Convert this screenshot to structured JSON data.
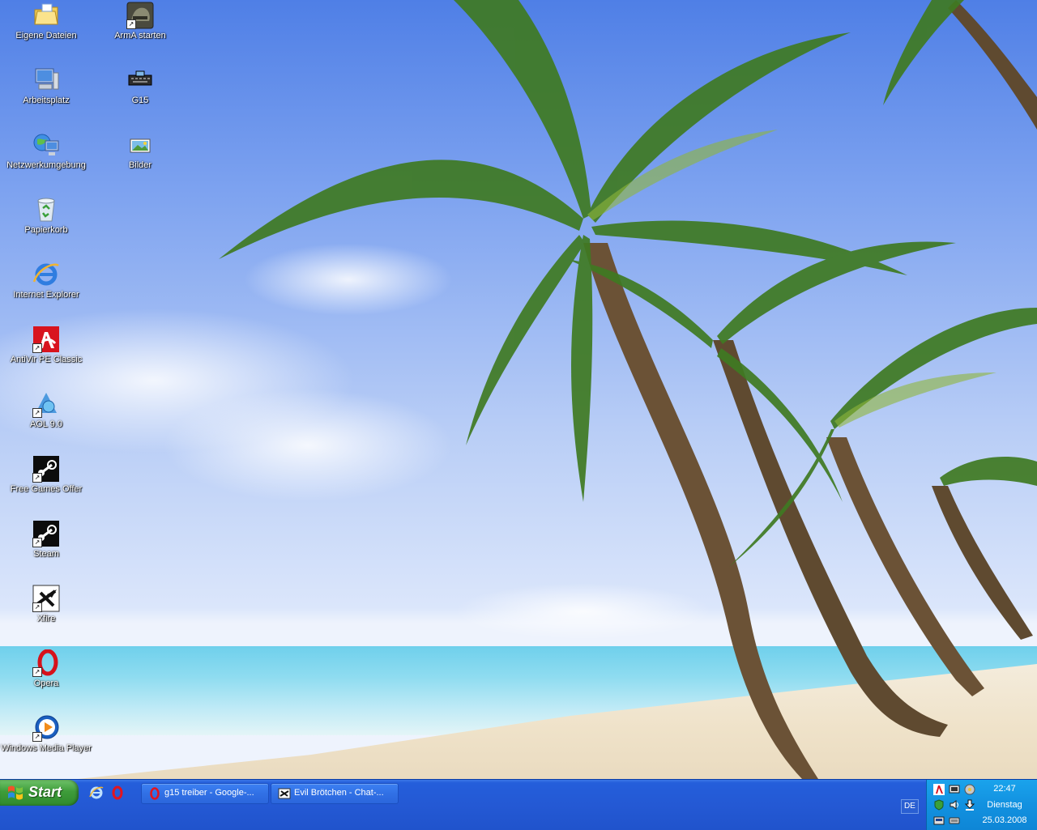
{
  "desktop": {
    "icons": [
      {
        "label": "Eigene Dateien",
        "icon": "my-documents-folder-icon"
      },
      {
        "label": "ArmA starten",
        "icon": "arma-game-icon"
      },
      {
        "label": "Arbeitsplatz",
        "icon": "my-computer-icon"
      },
      {
        "label": "G15",
        "icon": "g15-keyboard-icon"
      },
      {
        "label": "Netzwerkumgebung",
        "icon": "network-places-icon"
      },
      {
        "label": "Bilder",
        "icon": "pictures-icon"
      },
      {
        "label": "Papierkorb",
        "icon": "recycle-bin-icon"
      },
      {
        "label": "Internet Explorer",
        "icon": "internet-explorer-icon"
      },
      {
        "label": "AntiVir PE Classic",
        "icon": "antivir-umbrella-icon"
      },
      {
        "label": "AOL 9.0",
        "icon": "aol-icon"
      },
      {
        "label": "Free Games Offer",
        "icon": "steam-icon"
      },
      {
        "label": "Steam",
        "icon": "steam-icon"
      },
      {
        "label": "Xfire",
        "icon": "xfire-icon"
      },
      {
        "label": "Opera",
        "icon": "opera-icon"
      },
      {
        "label": "Windows Media Player",
        "icon": "media-player-icon"
      }
    ]
  },
  "taskbar": {
    "start_label": "Start",
    "tasks": [
      {
        "label": "g15 treiber - Google-...",
        "icon": "opera-icon"
      },
      {
        "label": "Evil Brötchen - Chat-...",
        "icon": "chat-window-icon"
      }
    ],
    "language": "DE",
    "clock": {
      "time": "22:47",
      "weekday": "Dienstag",
      "date": "25.03.2008"
    }
  },
  "colors": {
    "taskbar_blue": "#245edb",
    "start_green": "#3e9c3a",
    "tray_blue": "#1291e0"
  }
}
